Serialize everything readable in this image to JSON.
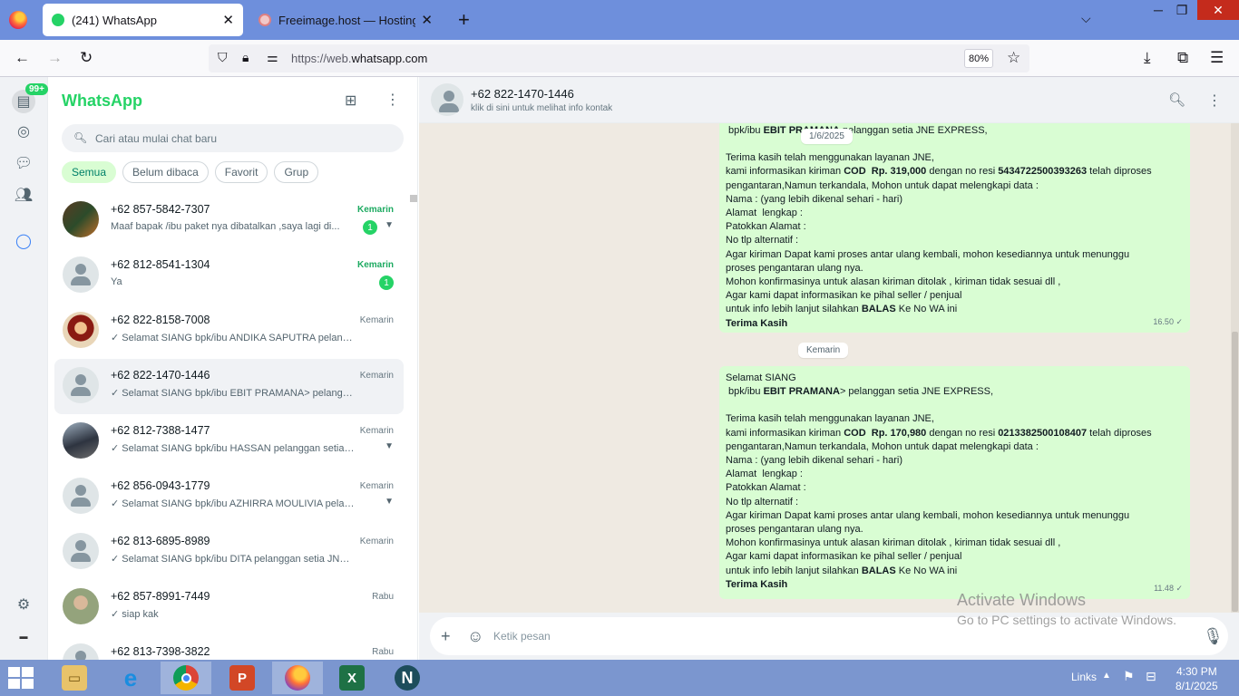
{
  "browser": {
    "tabs": [
      {
        "title": "(241) WhatsApp",
        "active": true
      },
      {
        "title": "Freeimage.host — Hosting Gam",
        "active": false
      }
    ],
    "url_prefix": "https://web.",
    "url_domain": "whatsapp.com",
    "zoom": "80%",
    "new_tab": "+",
    "close_glyph": "✕"
  },
  "rail": {
    "badge": "99+"
  },
  "sidebar": {
    "title": "WhatsApp",
    "search_placeholder": "Cari atau mulai chat baru",
    "filters": [
      "Semua",
      "Belum dibaca",
      "Favorit",
      "Grup"
    ],
    "chats": [
      {
        "name": "+62 857-5842-7307",
        "time": "Kemarin",
        "time_green": true,
        "preview": "Maaf bapak /ibu paket nya dibatalkan ,saya lagi di...",
        "unread": "1",
        "avatar": "img1",
        "chevron": true
      },
      {
        "name": "+62 812-8541-1304",
        "time": "Kemarin",
        "time_green": true,
        "preview": "Ya",
        "unread": "1",
        "avatar": "ph"
      },
      {
        "name": "+62 822-8158-7008",
        "time": "Kemarin",
        "preview": "✓ Selamat SIANG  bpk/ibu ANDIKA SAPUTRA pelanggan s...",
        "avatar": "img2"
      },
      {
        "name": "+62 822-1470-1446",
        "time": "Kemarin",
        "preview": "✓ Selamat SIANG  bpk/ibu EBIT PRAMANA> pelanggan s...",
        "avatar": "ph",
        "selected": true
      },
      {
        "name": "+62 812-7388-1477",
        "time": "Kemarin",
        "preview": "✓ Selamat SIANG  bpk/ibu HASSAN pelanggan setia J...",
        "avatar": "img3",
        "chevron": true
      },
      {
        "name": "+62 856-0943-1779",
        "time": "Kemarin",
        "preview": "✓ Selamat SIANG  bpk/ibu AZHIRRA MOULIVIA pelan...",
        "avatar": "ph",
        "chevron": true
      },
      {
        "name": "+62 813-6895-8989",
        "time": "Kemarin",
        "preview": "✓ Selamat SIANG  bpk/ibu DITA pelanggan setia JNE EXP...",
        "avatar": "ph"
      },
      {
        "name": "+62 857-8991-7449",
        "time": "Rabu",
        "preview": "✓ siap kak",
        "avatar": "img4"
      },
      {
        "name": "+62 813-7398-3822",
        "time": "Rabu",
        "preview": "",
        "avatar": "ph"
      }
    ]
  },
  "chat": {
    "contact": "+62 822-1470-1446",
    "subtitle": "klik di sini untuk melihat info kontak",
    "date_pill_top": "1/6/2025",
    "date_pill_mid": "Kemarin",
    "composer_placeholder": "Ketik pesan",
    "messages": [
      {
        "time": "16.50 ✓",
        "lines": [
          " bpk/ibu EBIT PRAMANA pelanggan setia JNE EXPRESS,",
          "",
          "Terima kasih telah menggunakan layanan JNE,",
          "kami informasikan kiriman COD  Rp. 319,000 dengan no resi 543472250039326​3 telah diproses",
          "pengantaran,Namun terkandala, Mohon untuk dapat melengkapi data :",
          "Nama : (yang lebih dikenal sehari - hari)",
          "Alamat  lengkap :",
          "Patokkan Alamat :",
          "No tlp alternatif :",
          "Agar kiriman Dapat kami proses antar ulang kembali, mohon kesediannya untuk menunggu",
          "proses pengantaran ulang nya.",
          "Mohon konfirmasinya untuk alasan kiriman ditolak , kiriman tidak sesuai dll ,",
          "Agar kami dapat informasikan ke pihal seller / penjual",
          "untuk info lebih lanjut silahkan BALAS Ke No WA ini",
          "Terima Kasih"
        ]
      },
      {
        "time": "11.48 ✓",
        "lines": [
          "Selamat SIANG",
          " bpk/ibu EBIT PRAMANA> pelanggan setia JNE EXPRESS,",
          "",
          "Terima kasih telah menggunakan layanan JNE,",
          "kami informasikan kiriman COD  Rp. 170,980 dengan no resi 0213382500108407 telah diproses",
          "pengantaran,Namun terkandala, Mohon untuk dapat melengkapi data :",
          "Nama : (yang lebih dikenal sehari - hari)",
          "Alamat  lengkap :",
          "Patokkan Alamat :",
          "No tlp alternatif :",
          "Agar kiriman Dapat kami proses antar ulang kembali, mohon kesediannya untuk menunggu",
          "proses pengantaran ulang nya.",
          "Mohon konfirmasinya untuk alasan kiriman ditolak , kiriman tidak sesuai dll ,",
          "Agar kami dapat informasikan ke pihal seller / penjual",
          "untuk info lebih lanjut silahkan BALAS Ke No WA ini",
          "Terima Kasih"
        ]
      }
    ]
  },
  "watermark": {
    "line1": "Activate Windows",
    "line2": "Go to PC settings to activate Windows."
  },
  "taskbar": {
    "tray_links": "Links",
    "time": "4:30 PM",
    "date": "8/1/2025"
  },
  "colors": {
    "accent": "#25d366",
    "bubble": "#d9fdd3",
    "chat_bg": "#efeae2",
    "taskbar": "#7b96cf",
    "titlebar": "#6e8fdc"
  }
}
